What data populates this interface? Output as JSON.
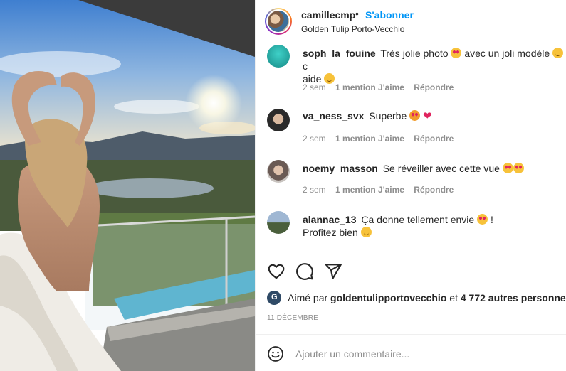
{
  "post": {
    "username": "camillecmp",
    "separator": "•",
    "follow_label": "S'abonner",
    "location": "Golden Tulip Porto-Vecchio"
  },
  "comments": [
    {
      "username": "soph_la_fouine",
      "text_parts": [
        "Très jolie photo",
        "avec un joli modèle",
        "c",
        "aide"
      ],
      "time": "2 sem",
      "likes": "1 mention J'aime",
      "reply": "Répondre"
    },
    {
      "username": "va_ness_svx",
      "text_parts": [
        "Superbe"
      ],
      "time": "2 sem",
      "likes": "1 mention J'aime",
      "reply": "Répondre"
    },
    {
      "username": "noemy_masson",
      "text_parts": [
        "Se réveiller avec cette vue"
      ],
      "time": "2 sem",
      "likes": "1 mention J'aime",
      "reply": "Répondre"
    },
    {
      "username": "alannac_13",
      "text_parts": [
        "Ça donne tellement envie",
        "!",
        "Profitez bien"
      ]
    }
  ],
  "likes": {
    "prefix": "Aimé par",
    "account": "goldentulipportovecchio",
    "conjunction": "et",
    "others": "4 772 autres personnes"
  },
  "date": "11 DÉCEMBRE",
  "add_comment": {
    "placeholder": "Ajouter un commentaire..."
  },
  "icons": {
    "like": "heart-outline-icon",
    "comment": "speech-bubble-icon",
    "share": "paper-plane-icon",
    "emoji": "smiley-icon"
  },
  "colors": {
    "accent": "#0095f6",
    "text": "#262626",
    "muted": "#8e8e8e",
    "divider": "#efefef"
  }
}
